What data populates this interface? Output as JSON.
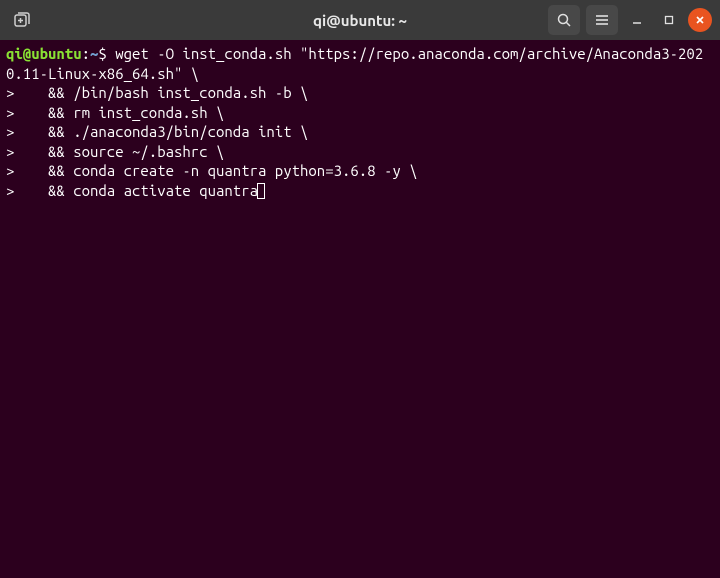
{
  "titlebar": {
    "title": "qi@ubuntu: ~"
  },
  "prompt": {
    "user_host": "qi@ubuntu",
    "separator": ":",
    "path": "~",
    "symbol": "$"
  },
  "lines": {
    "l0_cmd": " wget -O inst_conda.sh \"https://repo.anaconda.com/archive/Anaconda3-2020.11-Linux-x86_64.sh\" \\",
    "l1": ">    && /bin/bash inst_conda.sh -b \\",
    "l2": ">    && rm inst_conda.sh \\",
    "l3": ">    && ./anaconda3/bin/conda init \\",
    "l4": ">    && source ~/.bashrc \\",
    "l5": ">    && conda create -n quantra python=3.6.8 -y \\",
    "l6": ">    && conda activate quantra"
  }
}
